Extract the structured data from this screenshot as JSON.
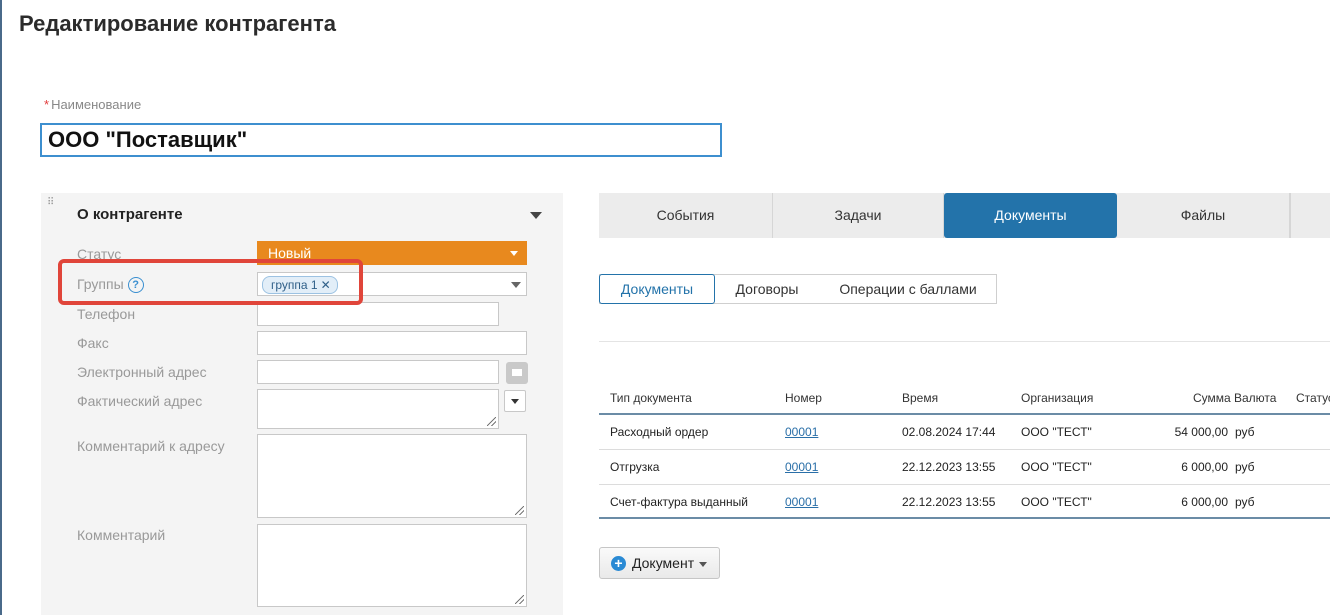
{
  "page": {
    "title": "Редактирование контрагента"
  },
  "name_field": {
    "label": "Наименование",
    "required_mark": "*",
    "value": "ООО \"Поставщик\""
  },
  "panel": {
    "title": "О контрагенте",
    "labels": {
      "status": "Статус",
      "groups": "Группы",
      "phone": "Телефон",
      "fax": "Факс",
      "email": "Электронный адрес",
      "address": "Фактический адрес",
      "address_comment": "Комментарий к адресу",
      "comment": "Комментарий"
    },
    "status_value": "Новый",
    "status_color": "#e8891e",
    "groups_help": "?",
    "group_tag": "группа 1",
    "group_tag_remove": "✕"
  },
  "tabs": [
    "События",
    "Задачи",
    "Документы",
    "Файлы"
  ],
  "active_tab": "Документы",
  "subtabs": [
    "Документы",
    "Договоры",
    "Операции с баллами"
  ],
  "active_subtab": "Документы",
  "documents_table": {
    "headers": [
      "Тип документа",
      "Номер",
      "Время",
      "Организация",
      "Сумма",
      "Валюта",
      "Статус"
    ],
    "rows": [
      {
        "type": "Расходный ордер",
        "number": "00001",
        "time": "02.08.2024 17:44",
        "org": "ООО \"ТЕСТ\"",
        "sum": "54 000,00",
        "currency": "руб"
      },
      {
        "type": "Отгрузка",
        "number": "00001",
        "time": "22.12.2023 13:55",
        "org": "ООО \"ТЕСТ\"",
        "sum": "6 000,00",
        "currency": "руб"
      },
      {
        "type": "Счет-фактура выданный",
        "number": "00001",
        "time": "22.12.2023 13:55",
        "org": "ООО \"ТЕСТ\"",
        "sum": "6 000,00",
        "currency": "руб"
      }
    ]
  },
  "add_document_button": {
    "label": "Документ",
    "icon": "plus-icon"
  },
  "colors": {
    "accent": "#2373aa",
    "highlight": "#e0453a"
  }
}
